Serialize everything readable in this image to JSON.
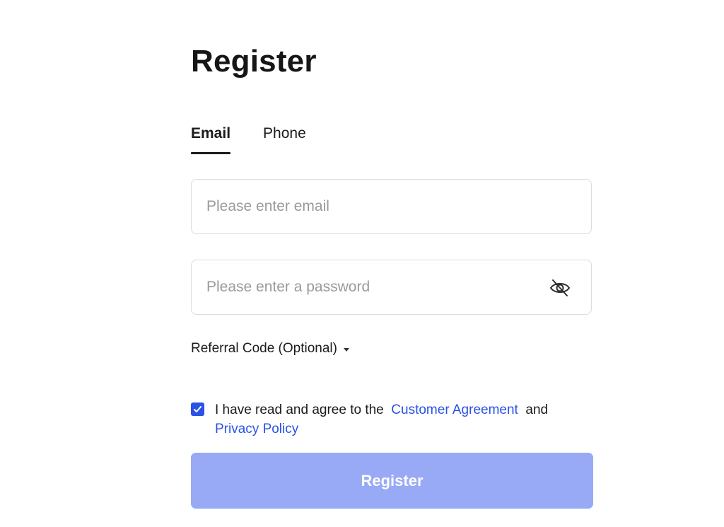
{
  "title": "Register",
  "tabs": [
    {
      "label": "Email",
      "active": true
    },
    {
      "label": "Phone",
      "active": false
    }
  ],
  "email": {
    "value": "",
    "placeholder": "Please enter email"
  },
  "password": {
    "value": "",
    "placeholder": "Please enter a password",
    "visibility_icon": "eye-off-icon"
  },
  "referral": {
    "label": "Referral Code (Optional)",
    "icon": "caret-down-icon"
  },
  "agreement": {
    "checked": true,
    "prefix": "I have read and agree to the",
    "link1": "Customer Agreement",
    "middle": "and",
    "link2": "Privacy Policy"
  },
  "submit": {
    "label": "Register"
  },
  "colors": {
    "accent": "#2a52e6",
    "button_disabled": "#98a9f6",
    "border": "#dcdcdc",
    "placeholder": "#9a9a9a"
  }
}
